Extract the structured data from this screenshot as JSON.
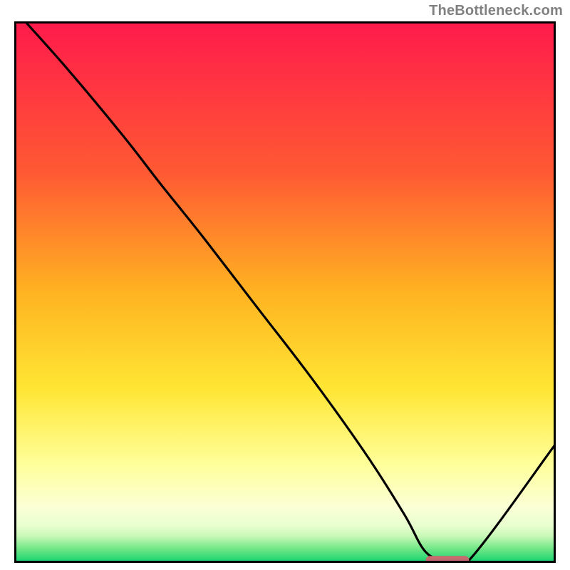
{
  "watermark": "TheBottleneck.com",
  "colors": {
    "frame": "#000000",
    "curve": "#000000",
    "marker_fill": "#c76a6f",
    "gradient_stops": [
      {
        "offset": 0.0,
        "color": "#ff1b4b"
      },
      {
        "offset": 0.28,
        "color": "#ff5a33"
      },
      {
        "offset": 0.5,
        "color": "#ffb321"
      },
      {
        "offset": 0.68,
        "color": "#ffe634"
      },
      {
        "offset": 0.82,
        "color": "#ffff9a"
      },
      {
        "offset": 0.9,
        "color": "#fbffd6"
      },
      {
        "offset": 0.935,
        "color": "#e8ffce"
      },
      {
        "offset": 0.955,
        "color": "#c6f8b6"
      },
      {
        "offset": 0.975,
        "color": "#7be98b"
      },
      {
        "offset": 1.0,
        "color": "#1fd571"
      }
    ]
  },
  "chart_data": {
    "type": "line",
    "title": "",
    "xlabel": "",
    "ylabel": "",
    "xlim": [
      0,
      100
    ],
    "ylim": [
      0,
      100
    ],
    "series": [
      {
        "name": "bottleneck-curve",
        "x": [
          2,
          10,
          20,
          27,
          35,
          45,
          55,
          65,
          72,
          76,
          80,
          84,
          100
        ],
        "values": [
          100,
          91,
          79,
          70,
          60,
          47,
          34,
          20,
          9,
          2,
          0.5,
          0.5,
          22
        ]
      }
    ],
    "marker": {
      "name": "optimal-range",
      "x_start": 76,
      "x_end": 84,
      "y": 0.5
    }
  }
}
